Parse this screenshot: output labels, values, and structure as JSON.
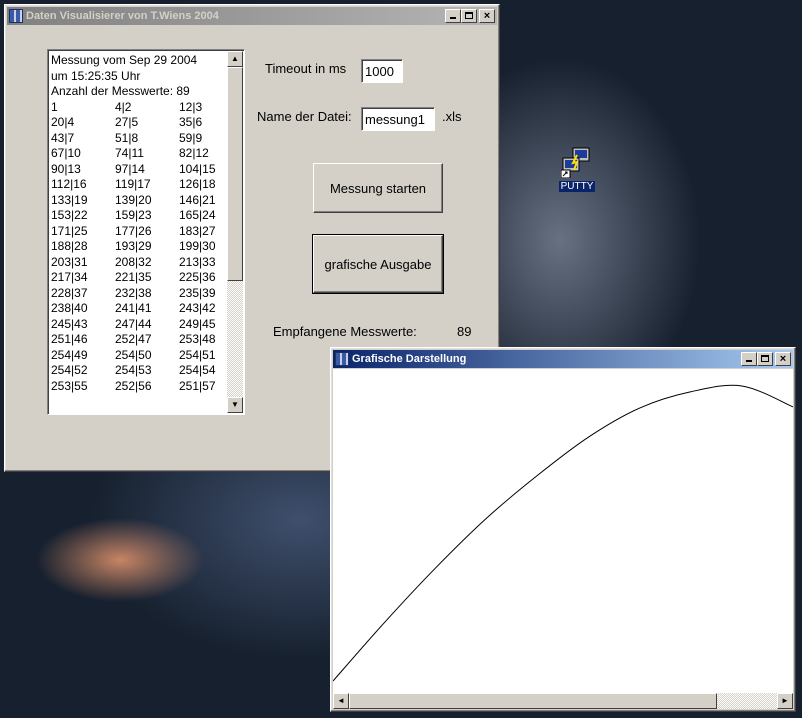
{
  "main_window": {
    "title": "Daten Visualisierer von T.Wiens 2004",
    "minimize_glyph": "_",
    "maximize_glyph": "□",
    "close_glyph": "×"
  },
  "list": {
    "header_lines": [
      "Messung vom Sep 29 2004",
      "um 15:25:35 Uhr",
      "Anzahl der Messwerte: 89"
    ],
    "rows": [
      [
        "1",
        "4|2",
        "12|3"
      ],
      [
        "20|4",
        "27|5",
        "35|6"
      ],
      [
        "43|7",
        "51|8",
        "59|9"
      ],
      [
        "67|10",
        "74|11",
        "82|12"
      ],
      [
        "90|13",
        "97|14",
        "104|15"
      ],
      [
        "112|16",
        "119|17",
        "126|18"
      ],
      [
        "133|19",
        "139|20",
        "146|21"
      ],
      [
        "153|22",
        "159|23",
        "165|24"
      ],
      [
        "171|25",
        "177|26",
        "183|27"
      ],
      [
        "188|28",
        "193|29",
        "199|30"
      ],
      [
        "203|31",
        "208|32",
        "213|33"
      ],
      [
        "217|34",
        "221|35",
        "225|36"
      ],
      [
        "228|37",
        "232|38",
        "235|39"
      ],
      [
        "238|40",
        "241|41",
        "243|42"
      ],
      [
        "245|43",
        "247|44",
        "249|45"
      ],
      [
        "251|46",
        "252|47",
        "253|48"
      ],
      [
        "254|49",
        "254|50",
        "254|51"
      ],
      [
        "254|52",
        "254|53",
        "254|54"
      ],
      [
        "253|55",
        "252|56",
        "251|57"
      ]
    ],
    "scroll_up_glyph": "▲",
    "scroll_down_glyph": "▼"
  },
  "form": {
    "timeout_label": "Timeout in ms",
    "timeout_value": "1000",
    "filename_label": "Name der Datei:",
    "filename_value": "messung1",
    "file_ext": ".xls",
    "start_button": "Messung starten",
    "graph_button": "grafische Ausgabe",
    "received_label": "Empfangene Messwerte:",
    "received_count": "89"
  },
  "desktop": {
    "putty_label": "PUTTY"
  },
  "graph_window": {
    "title": "Grafische Darstellung",
    "minimize_glyph": "_",
    "maximize_glyph": "□",
    "close_glyph": "×",
    "scroll_left_glyph": "◄",
    "scroll_right_glyph": "►"
  },
  "chart_data": {
    "type": "line",
    "line_color": "#000000",
    "background": "#ffffff",
    "grid": false,
    "x": [
      0,
      13,
      26,
      39,
      52,
      65,
      78,
      91,
      104,
      117
    ],
    "values": [
      0,
      50,
      97,
      140,
      177,
      210,
      235,
      249,
      254,
      236
    ],
    "ylim": [
      0,
      260
    ]
  }
}
